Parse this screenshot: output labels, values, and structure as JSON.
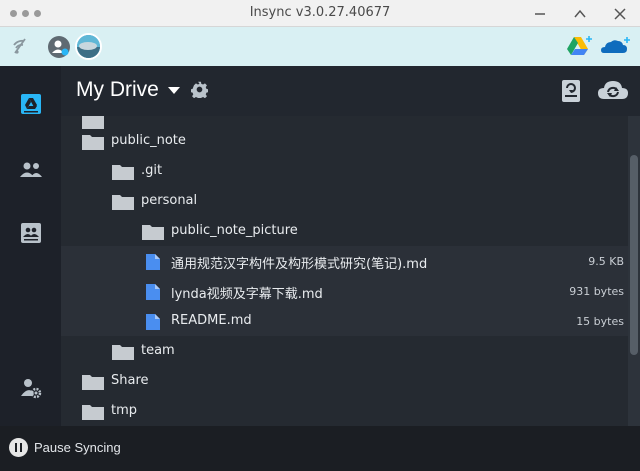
{
  "window": {
    "title": "Insync v3.0.27.40677"
  },
  "header": {
    "title": "My Drive"
  },
  "files": [
    {
      "name": "public_note",
      "type": "folder",
      "level": 0,
      "size": ""
    },
    {
      "name": ".git",
      "type": "folder",
      "level": 1,
      "size": ""
    },
    {
      "name": "personal",
      "type": "folder",
      "level": 1,
      "size": ""
    },
    {
      "name": "public_note_picture",
      "type": "folder",
      "level": 2,
      "size": ""
    },
    {
      "name": "通用规范汉字构件及构形模式研究(笔记).md",
      "type": "file",
      "level": 2,
      "size": "9.5 KB"
    },
    {
      "name": "lynda视频及字幕下载.md",
      "type": "file",
      "level": 2,
      "size": "931 bytes"
    },
    {
      "name": "README.md",
      "type": "file",
      "level": 2,
      "size": "15 bytes"
    },
    {
      "name": "team",
      "type": "folder",
      "level": 1,
      "size": ""
    },
    {
      "name": "Share",
      "type": "folder",
      "level": 0,
      "size": ""
    },
    {
      "name": "tmp",
      "type": "folder",
      "level": 0,
      "size": ""
    }
  ],
  "footer": {
    "pause_label": "Pause Syncing"
  },
  "colors": {
    "accent": "#29b6f6",
    "folder": "#c6cbd0",
    "file": "#4a8ef0"
  }
}
